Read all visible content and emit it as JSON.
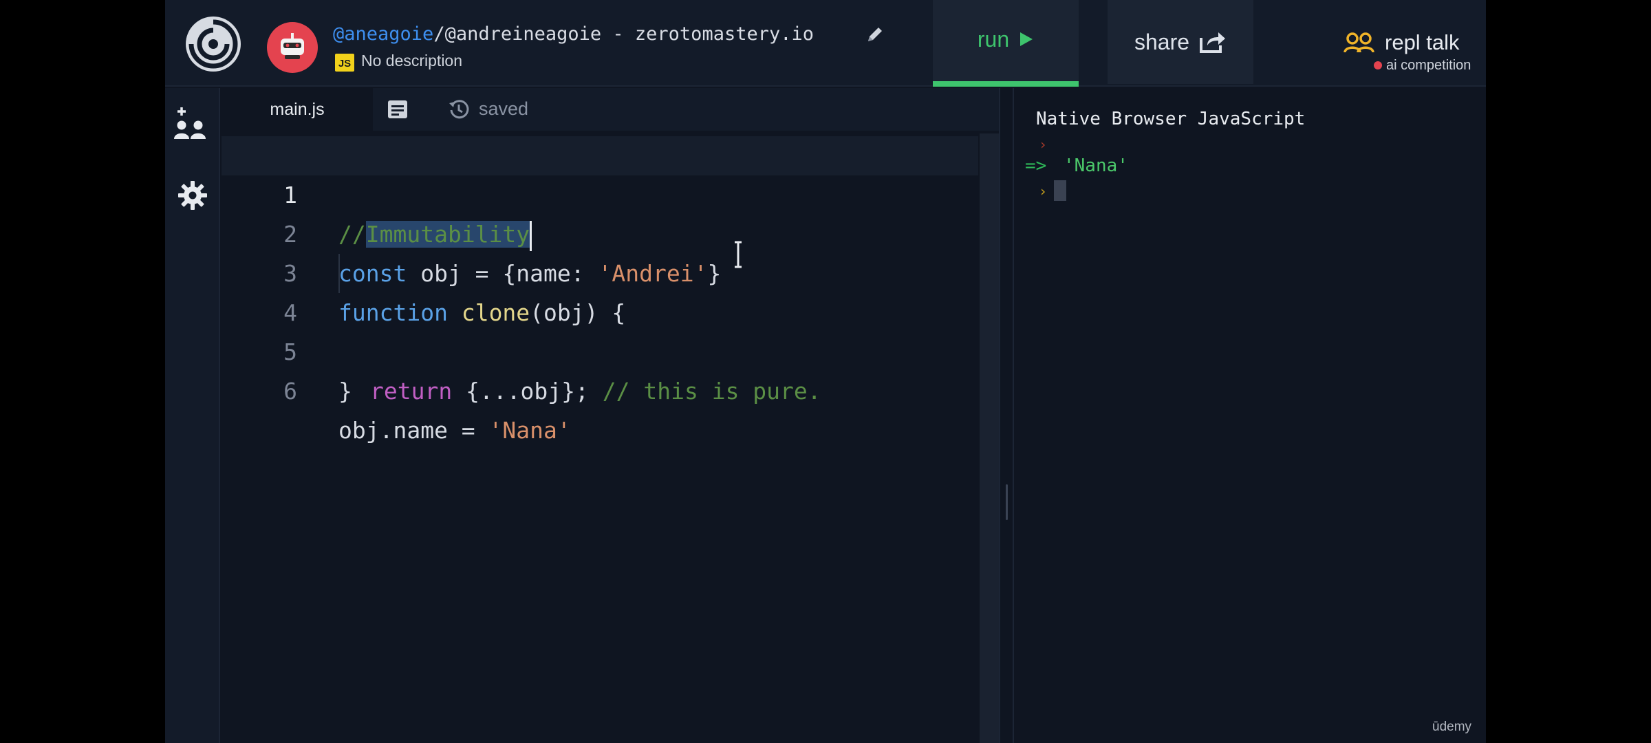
{
  "header": {
    "repl_user": "@aneagoie",
    "repl_title": "/@andreineagoie - zerotomastery.io",
    "language_badge": "JS",
    "description": "No description",
    "run_label": "run",
    "share_label": "share",
    "talk_label": "repl talk",
    "talk_sub": "ai competition"
  },
  "editor": {
    "tab_name": "main.js",
    "save_status": "saved",
    "line_numbers": [
      "1",
      "2",
      "3",
      "4",
      "5",
      "6"
    ],
    "code": {
      "l1_prefix": "//",
      "l1_selected": "Immutability",
      "l2_kw": "const",
      "l2_rest_a": " obj = {name: ",
      "l2_str": "'Andrei'",
      "l2_rest_b": "}",
      "l3_kw": "function",
      "l3_fn": "clone",
      "l3_rest": "(obj) {",
      "l4_kw": "return",
      "l4_rest": " {...obj}; ",
      "l4_comment": "// this is pure.",
      "l5": "}",
      "l6_rest": "obj.name = ",
      "l6_str": "'Nana'"
    }
  },
  "console": {
    "title": "Native Browser JavaScript",
    "prompt_glyph": "›",
    "output_arrow": "=>",
    "output_value": "'Nana'"
  },
  "watermark": "ūdemy",
  "colors": {
    "accent_run": "#3ec46d",
    "brand_red": "#e4434f",
    "selection": "#28466c"
  }
}
